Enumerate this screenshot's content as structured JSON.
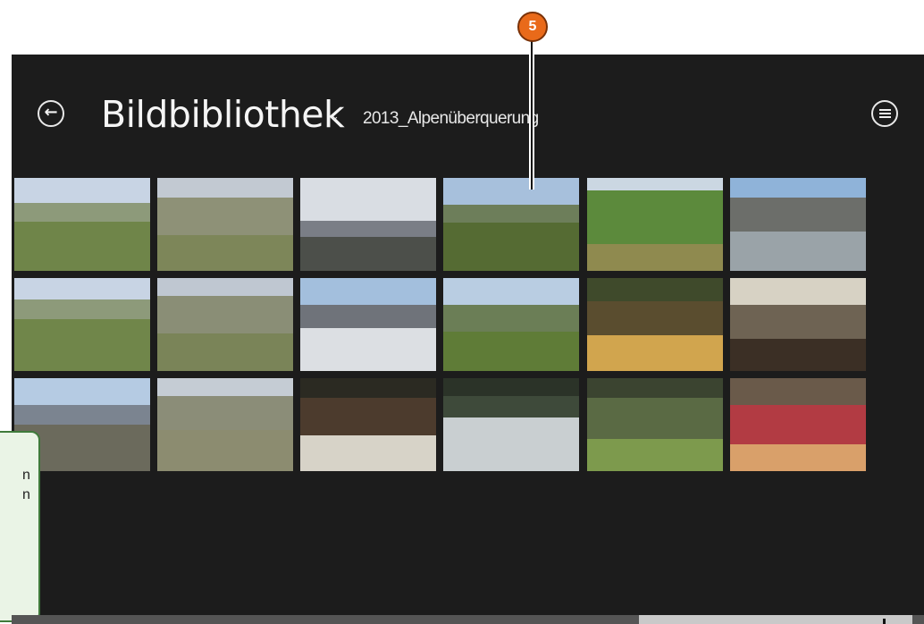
{
  "header": {
    "back_icon": "arrow-left-circle-icon",
    "title": "Bildbibliothek",
    "chevron_icon": "chevron-down-icon",
    "folder_name": "2013_Alpenüberquerung",
    "view_icon": "list-circle-icon"
  },
  "annotation": {
    "badge_number": "5",
    "callout_lines": [
      "n",
      "n"
    ]
  },
  "photos": [
    {
      "subject": "alpine valley"
    },
    {
      "subject": "rocky slope"
    },
    {
      "subject": "snowy peaks with clouds"
    },
    {
      "subject": "mountain valley view"
    },
    {
      "subject": "green trees"
    },
    {
      "subject": "river with building"
    },
    {
      "subject": "alpine valley"
    },
    {
      "subject": "rocky slope"
    },
    {
      "subject": "snowy mountains"
    },
    {
      "subject": "two hikers on meadow"
    },
    {
      "subject": "yellow hotel"
    },
    {
      "subject": "street archway"
    },
    {
      "subject": "valley with snow"
    },
    {
      "subject": "rocky slope"
    },
    {
      "subject": "mountain hut"
    },
    {
      "subject": "waterfall"
    },
    {
      "subject": "garden path"
    },
    {
      "subject": "pizza on table"
    }
  ]
}
